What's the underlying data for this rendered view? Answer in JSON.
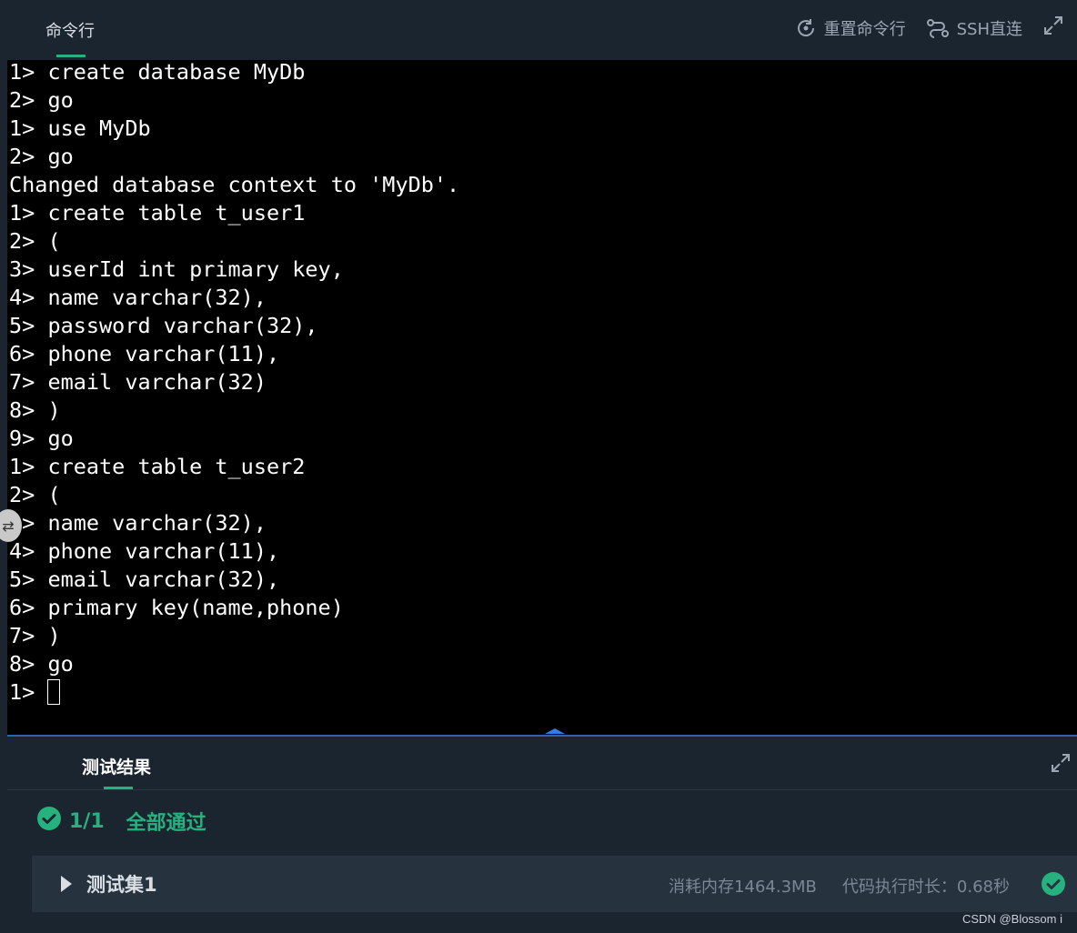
{
  "header": {
    "tab_label": "命令行",
    "reset_label": "重置命令行",
    "ssh_label": "SSH直连",
    "icons": [
      "reset-icon",
      "ssh-icon",
      "expand-icon"
    ]
  },
  "terminal": {
    "lines": [
      "1> create database MyDb",
      "2> go",
      "1> use MyDb",
      "2> go",
      "Changed database context to 'MyDb'.",
      "1> create table t_user1",
      "2> (",
      "3> userId int primary key,",
      "4> name varchar(32),",
      "5> password varchar(32),",
      "6> phone varchar(11),",
      "7> email varchar(32)",
      "8> )",
      "9> go",
      "1> create table t_user2",
      "2> (",
      "3> name varchar(32),",
      "4> phone varchar(11),",
      "5> email varchar(32),",
      "6> primary key(name,phone)",
      "7> )",
      "8> go"
    ],
    "prompt": "1> "
  },
  "side_toggle": {
    "glyph": "⇄"
  },
  "results": {
    "tab_label": "测试结果",
    "ratio": "1/1",
    "pass_label": "全部通过",
    "case_name": "测试集1",
    "memory": "消耗内存1464.3MB",
    "duration": "代码执行时长：0.68秒",
    "accent": "#25b27f"
  },
  "watermark": "CSDN @Blossom i"
}
